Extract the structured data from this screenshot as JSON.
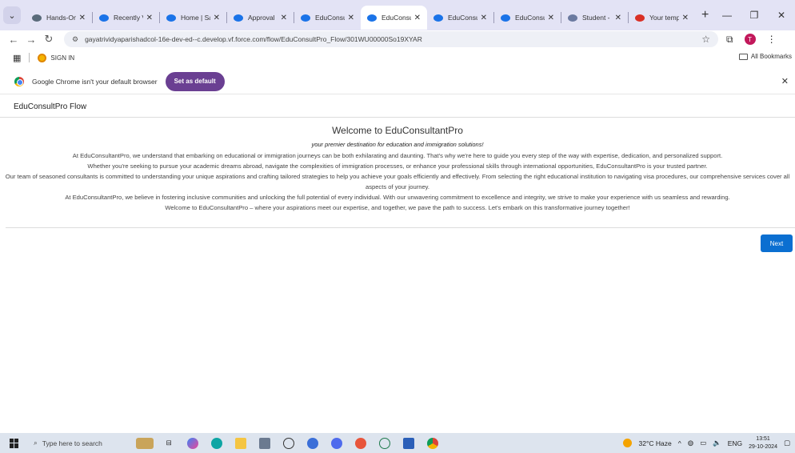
{
  "browser": {
    "tabs": [
      {
        "title": "Hands-On",
        "color": "#5a6b7a",
        "active": false
      },
      {
        "title": "Recently V",
        "color": "#1a73e8",
        "active": false
      },
      {
        "title": "Home | Sa",
        "color": "#1a73e8",
        "active": false
      },
      {
        "title": "Approval",
        "color": "#1a73e8",
        "active": false
      },
      {
        "title": "EduConsu",
        "color": "#1a73e8",
        "active": false
      },
      {
        "title": "EduConsu",
        "color": "#1a73e8",
        "active": true
      },
      {
        "title": "EduConsu",
        "color": "#1a73e8",
        "active": false
      },
      {
        "title": "EduConsu",
        "color": "#1a73e8",
        "active": false
      },
      {
        "title": "Student -",
        "color": "#6b7aa0",
        "active": false
      },
      {
        "title": "Your temp",
        "color": "#d93025",
        "active": false
      }
    ],
    "url": "gayatrividyaparishadcol-16e-dev-ed--c.develop.vf.force.com/flow/EduConsultPro_Flow/301WU00000So19XYAR",
    "profile_initial": "T",
    "bookmarks": {
      "sign_in": "SIGN IN",
      "all_bookmarks": "All Bookmarks"
    },
    "infobar": {
      "message": "Google Chrome isn't your default browser",
      "button": "Set as default"
    }
  },
  "page": {
    "header": "EduConsultPro Flow",
    "title": "Welcome to EduConsultantPro",
    "subtitle": "your premier destination for education and immigration solutions!",
    "paragraphs": [
      "At EduConsultantPro, we understand that embarking on educational or immigration journeys can be both exhilarating and daunting. That's why we're here to guide you every step of the way with expertise, dedication, and personalized support.",
      "Whether you're seeking to pursue your academic dreams abroad, navigate the complexities of immigration processes, or enhance your professional skills through international opportunities, EduConsultantPro is your trusted partner.",
      "Our team of seasoned consultants is committed to understanding your unique aspirations and crafting tailored strategies to help you achieve your goals efficiently and effectively. From selecting the right educational institution to navigating visa procedures, our comprehensive services cover all aspects of your journey.",
      "At EduConsultantPro, we believe in fostering inclusive communities and unlocking the full potential of every individual. With our unwavering commitment to excellence and integrity, we strive to make your experience with us seamless and rewarding.",
      "Welcome to EduConsultantPro – where your aspirations meet our expertise, and together, we pave the path to success. Let's embark on this transformative journey together!"
    ],
    "next_button": "Next"
  },
  "taskbar": {
    "search_placeholder": "Type here to search",
    "weather": "32°C  Haze",
    "language": "ENG",
    "time": "13:51",
    "date": "29-10-2024"
  }
}
